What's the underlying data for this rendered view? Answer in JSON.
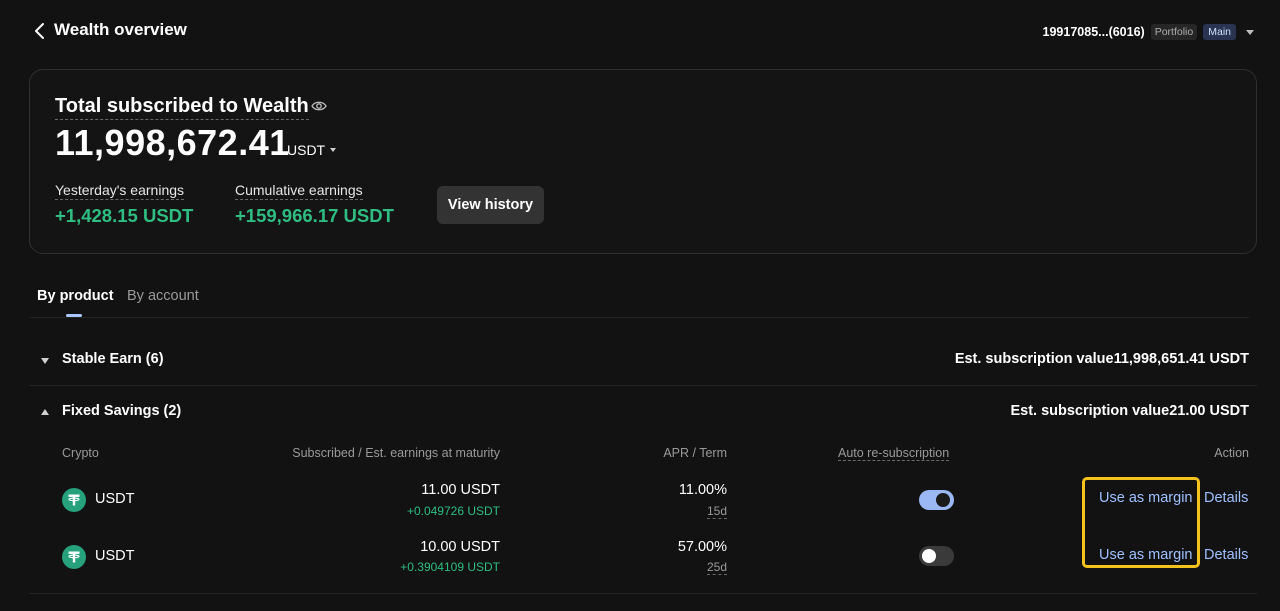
{
  "header": {
    "title": "Wealth overview",
    "account_id": "19917085...(6016)",
    "account_tag": "Portfolio",
    "account_badge": "Main"
  },
  "summary": {
    "title": "Total subscribed to Wealth",
    "total": "11,998,672.41",
    "currency": "USDT",
    "yesterday_label": "Yesterday's earnings",
    "yesterday_value": "+1,428.15 USDT",
    "cumulative_label": "Cumulative earnings",
    "cumulative_value": "+159,966.17 USDT",
    "view_history_label": "View history"
  },
  "tabs": [
    {
      "label": "By product",
      "active": true
    },
    {
      "label": "By account",
      "active": false
    }
  ],
  "groups": [
    {
      "name": "Stable Earn (6)",
      "est_label": "Est. subscription value",
      "est_value": "11,998,651.41 USDT",
      "expanded": false
    },
    {
      "name": "Fixed Savings (2)",
      "est_label": "Est. subscription value",
      "est_value": "21.00 USDT",
      "expanded": true
    }
  ],
  "table": {
    "headers": {
      "crypto": "Crypto",
      "subscribed": "Subscribed / Est. earnings at maturity",
      "apr": "APR / Term",
      "auto": "Auto re-subscription",
      "action": "Action"
    },
    "rows": [
      {
        "coin": "USDT",
        "subscribed": "11.00 USDT",
        "earnings": "+0.049726 USDT",
        "apr": "11.00%",
        "term": "15d",
        "auto_resubscribe": true,
        "action_margin": "Use as margin",
        "action_details": "Details"
      },
      {
        "coin": "USDT",
        "subscribed": "10.00 USDT",
        "earnings": "+0.3904109 USDT",
        "apr": "57.00%",
        "term": "25d",
        "auto_resubscribe": false,
        "action_margin": "Use as margin",
        "action_details": "Details"
      }
    ]
  },
  "colors": {
    "positive": "#2fbd82",
    "link": "#9fc0ff",
    "highlight": "#f5c11c",
    "tether": "#26a17b"
  },
  "icons": {
    "back": "chevron-left-icon",
    "eye": "eye-icon",
    "coin": "tether-icon"
  }
}
